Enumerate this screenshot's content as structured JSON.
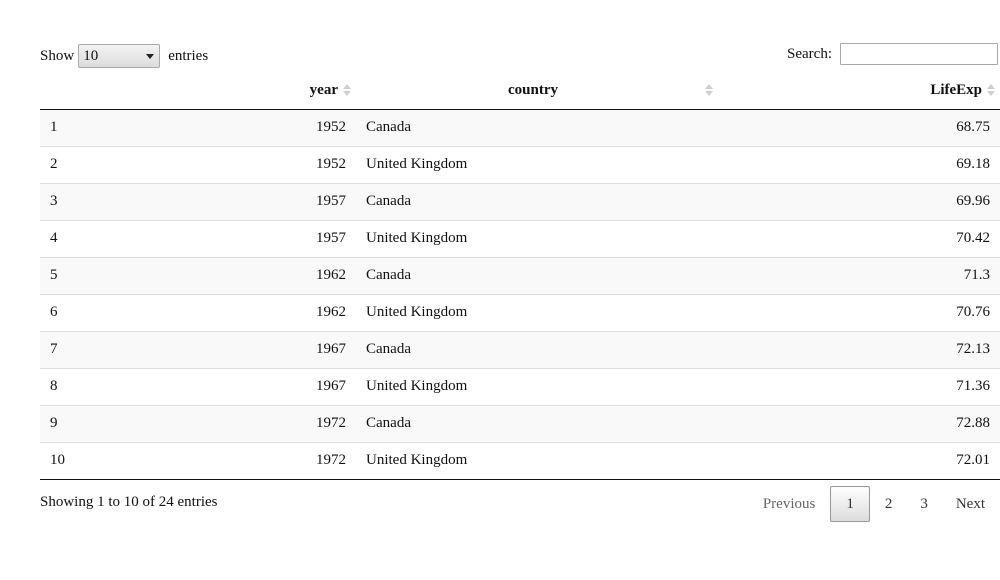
{
  "length_control": {
    "label_before": "Show",
    "selected": "10",
    "label_after": "entries"
  },
  "search": {
    "label": "Search:",
    "value": ""
  },
  "columns": {
    "index": "",
    "year": "year",
    "country": "country",
    "life": "LifeExp"
  },
  "rows": [
    {
      "index": "1",
      "year": "1952",
      "country": "Canada",
      "life": "68.75"
    },
    {
      "index": "2",
      "year": "1952",
      "country": "United Kingdom",
      "life": "69.18"
    },
    {
      "index": "3",
      "year": "1957",
      "country": "Canada",
      "life": "69.96"
    },
    {
      "index": "4",
      "year": "1957",
      "country": "United Kingdom",
      "life": "70.42"
    },
    {
      "index": "5",
      "year": "1962",
      "country": "Canada",
      "life": "71.3"
    },
    {
      "index": "6",
      "year": "1962",
      "country": "United Kingdom",
      "life": "70.76"
    },
    {
      "index": "7",
      "year": "1967",
      "country": "Canada",
      "life": "72.13"
    },
    {
      "index": "8",
      "year": "1967",
      "country": "United Kingdom",
      "life": "71.36"
    },
    {
      "index": "9",
      "year": "1972",
      "country": "Canada",
      "life": "72.88"
    },
    {
      "index": "10",
      "year": "1972",
      "country": "United Kingdom",
      "life": "72.01"
    }
  ],
  "info": "Showing 1 to 10 of 24 entries",
  "pagination": {
    "previous": "Previous",
    "pages": [
      "1",
      "2",
      "3"
    ],
    "current": "1",
    "next": "Next"
  },
  "colors": {
    "stripe": "#f9f9f9",
    "border": "#111111",
    "row_divider": "#dddddd",
    "sort_icon": "#cfcfcf"
  },
  "icons": {
    "sort": "sort-both-icon",
    "dropdown": "chevron-down-icon"
  }
}
